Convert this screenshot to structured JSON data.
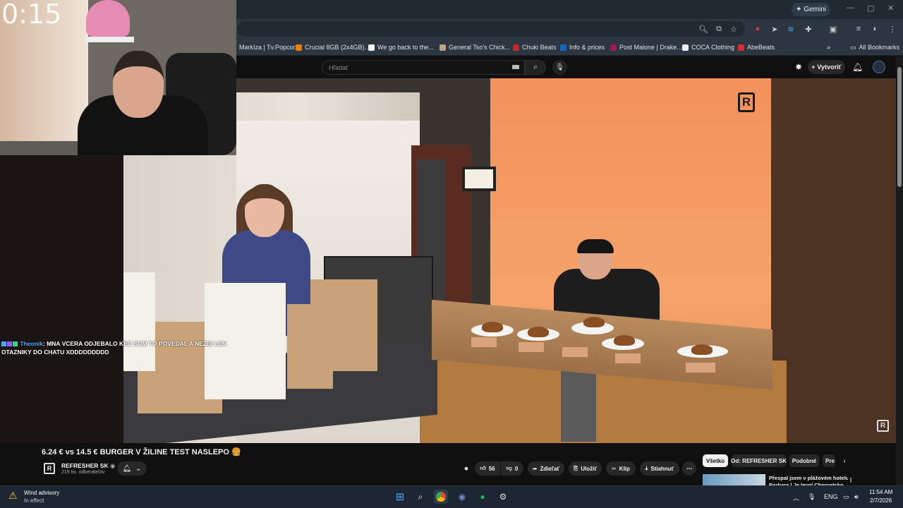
{
  "browser": {
    "gemini_label": "Gemini",
    "bookmarks": [
      {
        "label": "Markíza | Tv.Popcor...",
        "color": "#e53935"
      },
      {
        "label": "Crucial 8GB (2x4GB)...",
        "color": "#f57c00"
      },
      {
        "label": "We go back to the...",
        "color": "#ffffff"
      },
      {
        "label": "General Tso's Chick...",
        "color": "#c0a080"
      },
      {
        "label": "Chuki Beats",
        "color": "#c62828"
      },
      {
        "label": "Info & prices",
        "color": "#1565c0"
      },
      {
        "label": "Post Malone | Drake...",
        "color": "#ad1457"
      },
      {
        "label": "COCA Clothing",
        "color": "#eeeeee"
      },
      {
        "label": "AbeBeats",
        "color": "#d32f2f"
      }
    ],
    "all_bookmarks_label": "All Bookmarks"
  },
  "youtube": {
    "search_placeholder": "Hľadať",
    "create_label": "Vytvoriť",
    "video_title": "6.24 € vs 14.5 € BURGER V ŽILINE TEST NASLEPO 🍔",
    "channel_name": "REFRESHER SK",
    "channel_subs": "219 tis. odberateľov",
    "likes": "56",
    "dislikes": "0",
    "share_label": "Zdieľať",
    "save_label": "Uložiť",
    "clip_label": "Klip",
    "download_label": "Stiahnuť",
    "chips": [
      {
        "label": "Všetko",
        "active": true
      },
      {
        "label": "Od: REFRESHER SK",
        "active": false
      },
      {
        "label": "Podobné",
        "active": false
      },
      {
        "label": "Pre",
        "active": false
      }
    ],
    "recommendation_title": "Přespal jsem v plážovém hotelu",
    "recommendation_title2": "Barbara | Je levní Chorvatsko"
  },
  "stream": {
    "timer": "0:15",
    "chat_user": "Theonik",
    "chat_message": ": MNA VCERA ODJEBALO KED SOM TO POVEDAL A NEZBI LEN OTAZNIKY DO CHATU XDDDDDDDDD"
  },
  "taskbar": {
    "weather_title": "Wind advisory",
    "weather_sub": "In effect",
    "language": "ENG",
    "time": "11:54 AM",
    "date": "2/7/2026"
  },
  "colors": {
    "accent_orange": "#f5a36b",
    "yt_bg": "#0f0f0f",
    "chat_user": "#4aa8ff"
  }
}
